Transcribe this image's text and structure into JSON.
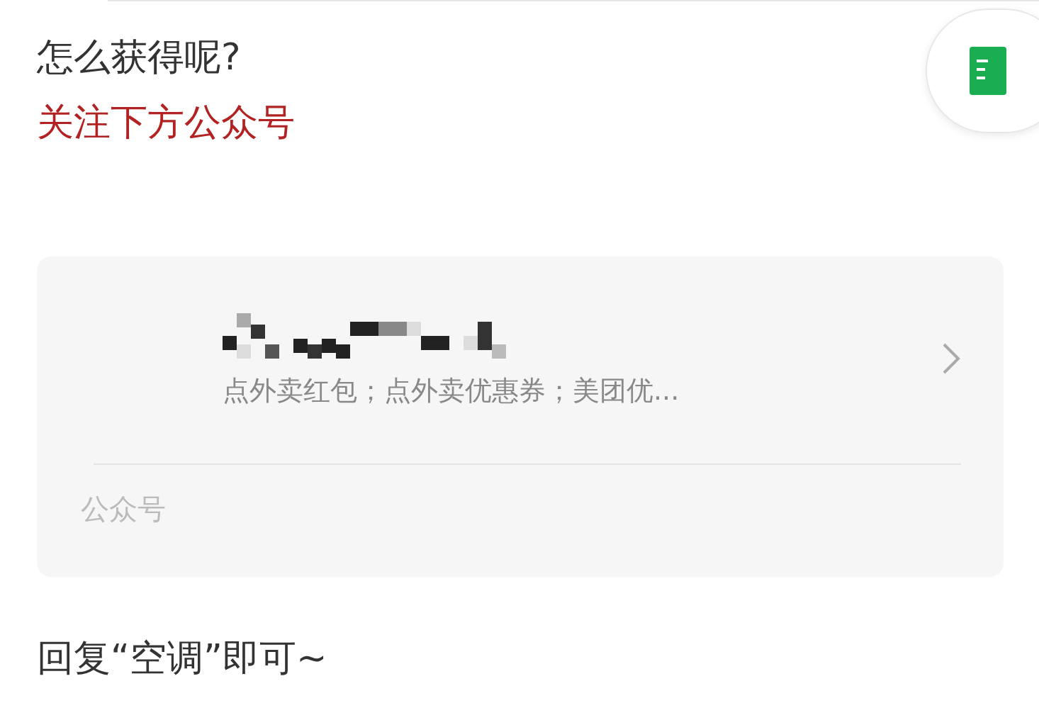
{
  "heading": "怎么获得呢?",
  "instruction": "关注下方公众号",
  "account_card": {
    "description": "点外卖红包；点外卖优惠券；美团优...",
    "type_label": "公众号"
  },
  "reply_hint": "回复“空调”即可~"
}
